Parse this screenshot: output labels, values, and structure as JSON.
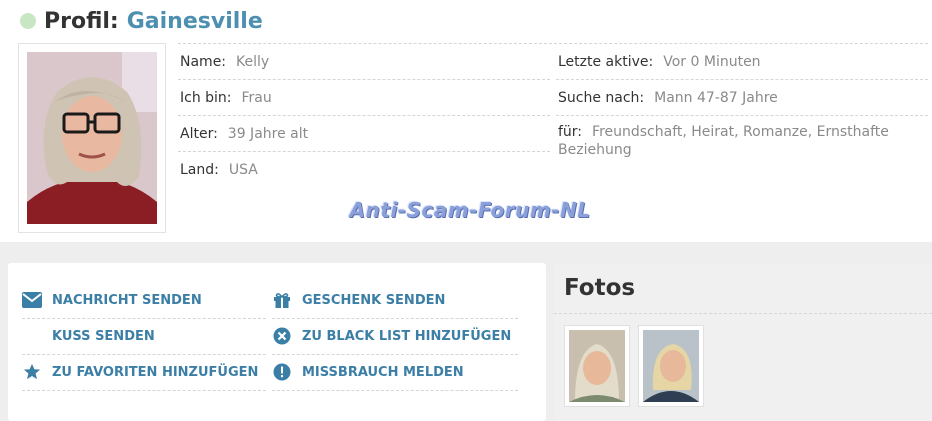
{
  "profile": {
    "title_prefix": "Profil:",
    "city": "Gainesville",
    "status_color": "#c8e6c4"
  },
  "info": {
    "name_label": "Name:",
    "name_value": "Kelly",
    "ichbin_label": "Ich bin:",
    "ichbin_value": "Frau",
    "alter_label": "Alter:",
    "alter_value": "39 Jahre alt",
    "land_label": "Land:",
    "land_value": "USA",
    "aktiv_label": "Letzte aktive:",
    "aktiv_value": "Vor 0 Minuten",
    "suche_label": "Suche nach:",
    "suche_value": "Mann 47-87 Jahre",
    "fuer_label": "für:",
    "fuer_value": "Freundschaft, Heirat, Romanze, Ernsthafte Beziehung"
  },
  "watermark": "Anti-Scam-Forum-NL",
  "actions": {
    "nachricht": "NACHRICHT SENDEN",
    "kuss": "KUSS SENDEN",
    "favoriten": "ZU FAVORITEN HINZUFÜGEN",
    "geschenk": "GESCHENK SENDEN",
    "blacklist": "ZU BLACK LIST HINZUFÜGEN",
    "missbrauch": "MISSBRAUCH MELDEN"
  },
  "fotos": {
    "title": "Fotos"
  },
  "colors": {
    "accent": "#3b7ea6",
    "city": "#4d8fb0"
  },
  "icons": [
    "envelope-icon",
    "gift-icon",
    "close-circle-icon",
    "star-icon",
    "exclamation-circle-icon"
  ]
}
